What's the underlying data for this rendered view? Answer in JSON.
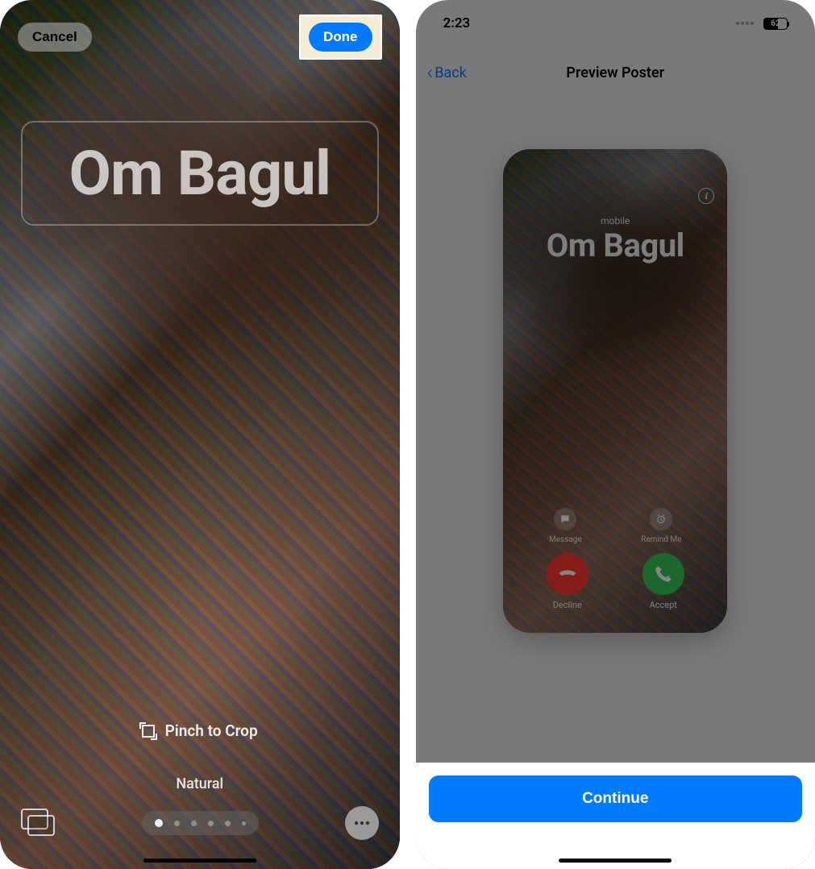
{
  "left": {
    "cancel_label": "Cancel",
    "done_label": "Done",
    "contact_name": "Om Bagul",
    "pinch_label": "Pinch to Crop",
    "filter_label": "Natural"
  },
  "right": {
    "status_time": "2:23",
    "battery_pct": "62",
    "back_label": "Back",
    "nav_title": "Preview Poster",
    "poster": {
      "line_type": "mobile",
      "contact_name": "Om Bagul",
      "message_label": "Message",
      "remind_label": "Remind Me",
      "decline_label": "Decline",
      "accept_label": "Accept"
    },
    "continue_label": "Continue"
  },
  "colors": {
    "accent": "#007aff",
    "decline": "#ff3b30",
    "accept": "#34c759",
    "highlight_box": "#f5ecd4"
  }
}
